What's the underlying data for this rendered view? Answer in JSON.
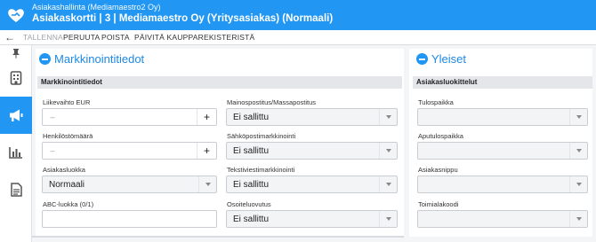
{
  "header": {
    "app_title": "Asiakashallinta (Mediamaestro2 Oy)",
    "card_title": "Asiakaskortti | 3 | Mediamaestro Oy (Yritysasiakas) (Normaali)",
    "brand_color": "#2196f3"
  },
  "toolbar": {
    "back_icon": "arrow-left-icon",
    "items": [
      "TALLENNA",
      "PERUUTA",
      "POISTA",
      "PÄIVITÄ KAUPPAREKISTERISTÄ"
    ]
  },
  "sidebar": {
    "pin_icon": "pin-icon",
    "items": [
      {
        "icon": "building-icon",
        "active": false
      },
      {
        "icon": "megaphone-icon",
        "active": true
      },
      {
        "icon": "bar-chart-icon",
        "active": false
      },
      {
        "icon": "document-icon",
        "active": false
      }
    ]
  },
  "marketing": {
    "title": "Markkinointitiedot",
    "subheader": "Markkinointitiedot",
    "liikevaihto_label": "Liikevaihto EUR",
    "liikevaihto_value": "",
    "henkilosto_label": "Henkilöstömäärä",
    "henkilosto_value": "",
    "stepper_minus": "–",
    "stepper_plus": "+",
    "asiakasluokka_label": "Asiakasluokka",
    "asiakasluokka_value": "Normaali",
    "abc_label": "ABC-luokka (0/1)",
    "abc_value": "",
    "mainos_label": "Mainospostitus/Massapostitus",
    "mainos_value": "Ei sallittu",
    "sahkoposti_label": "Sähköpostimarkkinointi",
    "sahkoposti_value": "Ei sallittu",
    "teksti_label": "Tekstiviestimarkkinointi",
    "teksti_value": "Ei sallittu",
    "osoite_label": "Osoiteluovutus",
    "osoite_value": "Ei sallittu"
  },
  "general": {
    "title": "Yleiset",
    "subheader": "Asiakasluokittelut",
    "tulospaikka_label": "Tulospaikka",
    "apu_label": "Aputulospaikka",
    "nippu_label": "Asiakasnippu",
    "toimiala_label": "Toimialakoodi"
  }
}
